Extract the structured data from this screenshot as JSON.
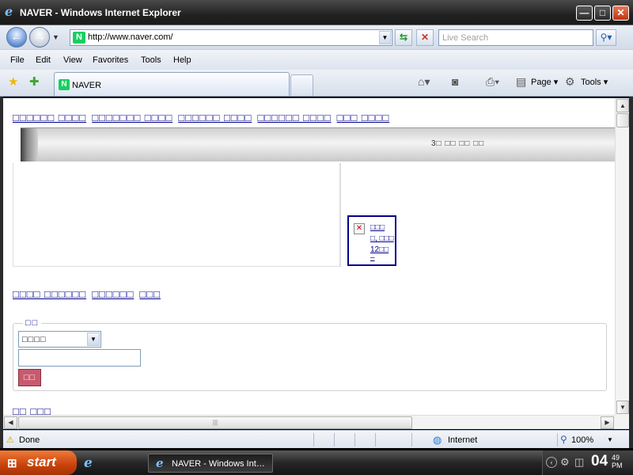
{
  "window": {
    "title": "NAVER - Windows Internet Explorer",
    "minimize_glyph": "—",
    "maximize_glyph": "□",
    "close_glyph": "✕"
  },
  "address_bar": {
    "url": "http://www.naver.com/",
    "favicon_text": "N",
    "search_placeholder": "Live Search"
  },
  "menu": [
    "File",
    "Edit",
    "View",
    "Favorites",
    "Tools",
    "Help"
  ],
  "tab": {
    "label": "NAVER",
    "favicon_text": "N"
  },
  "commands": {
    "page": "Page",
    "tools": "Tools"
  },
  "content": {
    "top_links": [
      "□□□□□□ □□□□",
      "□□□□□□□ □□□□",
      "□□□□□□ □□□□",
      "□□□□□□ □□□□",
      "□□□ □□□□"
    ],
    "banner_text": "3□ □□ □□ □□",
    "image_alt": [
      "□□□",
      "□, □□□",
      "12□□",
      "–"
    ],
    "mid_links": [
      "□□□□ □□□□□□",
      "□□□□□□",
      "□□□"
    ],
    "fieldset_legend": "□□",
    "select_value": "□□□□",
    "search_button": "□□",
    "cutoff_text": "□□ □□□"
  },
  "status": {
    "text": "Done",
    "zone": "Internet",
    "zoom": "100%"
  },
  "taskbar": {
    "start_label": "start",
    "task_label": "NAVER - Windows Int…",
    "clock_hour": "04",
    "clock_min": "49",
    "clock_ampm": "PM"
  }
}
